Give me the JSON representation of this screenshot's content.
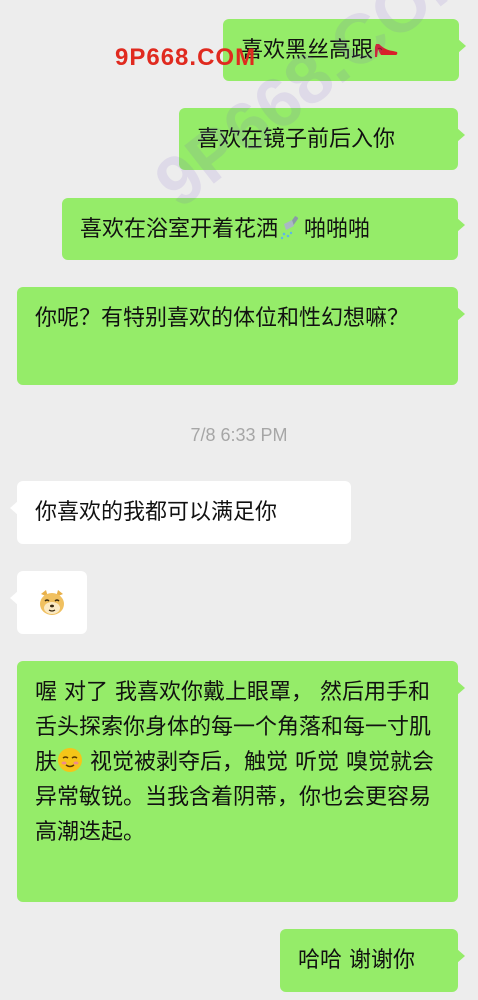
{
  "messages": [
    {
      "id": "m1",
      "side": "sent",
      "text": "喜欢黑丝高跟",
      "emoji": "high-heel-icon"
    },
    {
      "id": "m2",
      "side": "sent",
      "text": "喜欢在镜子前后入你"
    },
    {
      "id": "m3",
      "side": "sent",
      "text_before": "喜欢在浴室开着花洒",
      "emoji": "shower-icon",
      "text_after": "啪啪啪"
    },
    {
      "id": "m4",
      "side": "sent",
      "text": "你呢？有特别喜欢的体位和性幻想嘛？"
    },
    {
      "id": "m5",
      "side": "recv",
      "text": "你喜欢的我都可以满足你"
    },
    {
      "id": "m6",
      "side": "recv",
      "emoji": "doge-icon"
    },
    {
      "id": "m7",
      "side": "sent",
      "text_before": "喔 对了 我喜欢你戴上眼罩， 然后用手和舌头探索你身体的每一个角落和每一寸肌肤",
      "emoji": "blush-face-icon",
      "text_after": " 视觉被剥夺后，触觉 听觉 嗅觉就会异常敏锐。当我含着阴蒂，你也会更容易高潮迭起。"
    },
    {
      "id": "m8",
      "side": "sent",
      "text": "哈哈 谢谢你"
    }
  ],
  "timestamp": "7/8 6:33 PM",
  "watermarks": {
    "top": "9P668.COM",
    "diagonal": "9P668.COM"
  },
  "colors": {
    "background": "#ededed",
    "sent_bubble": "#95ec69",
    "recv_bubble": "#ffffff",
    "timestamp": "#a6a6a6",
    "watermark_red": "#e02a1f"
  }
}
